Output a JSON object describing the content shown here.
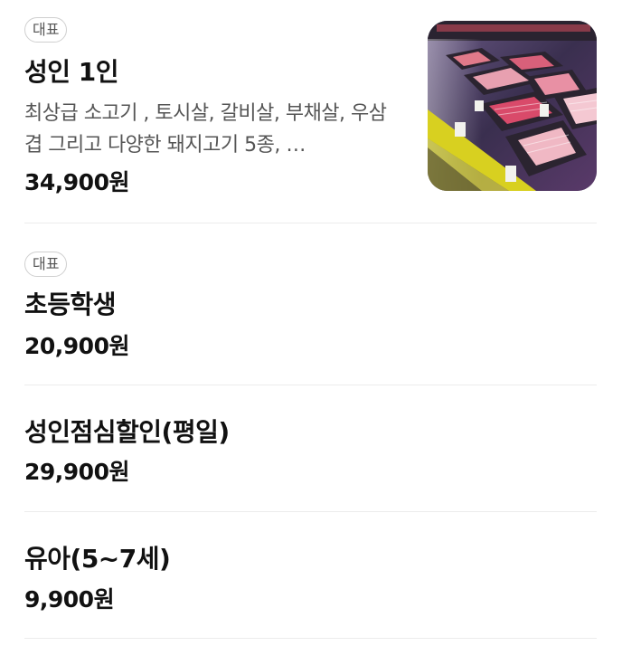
{
  "menu": {
    "items": [
      {
        "badge": "대표",
        "name": "성인 1인",
        "description": "최상급 소고기 , 토시살, 갈비살, 부채살, 우삼겹 그리고 다양한 돼지고기 5종, …",
        "price": "34,900원",
        "image_alt": "meat-display-photo"
      },
      {
        "badge": "대표",
        "name": "초등학생",
        "price": "20,900원"
      },
      {
        "name": "성인점심할인(평일)",
        "price": "29,900원"
      },
      {
        "name": "유아(5~7세)",
        "price": "9,900원"
      }
    ]
  },
  "colors": {
    "text_primary": "#111111",
    "text_secondary": "#555555",
    "badge_border": "#cfcfcf",
    "divider": "#ececec"
  }
}
